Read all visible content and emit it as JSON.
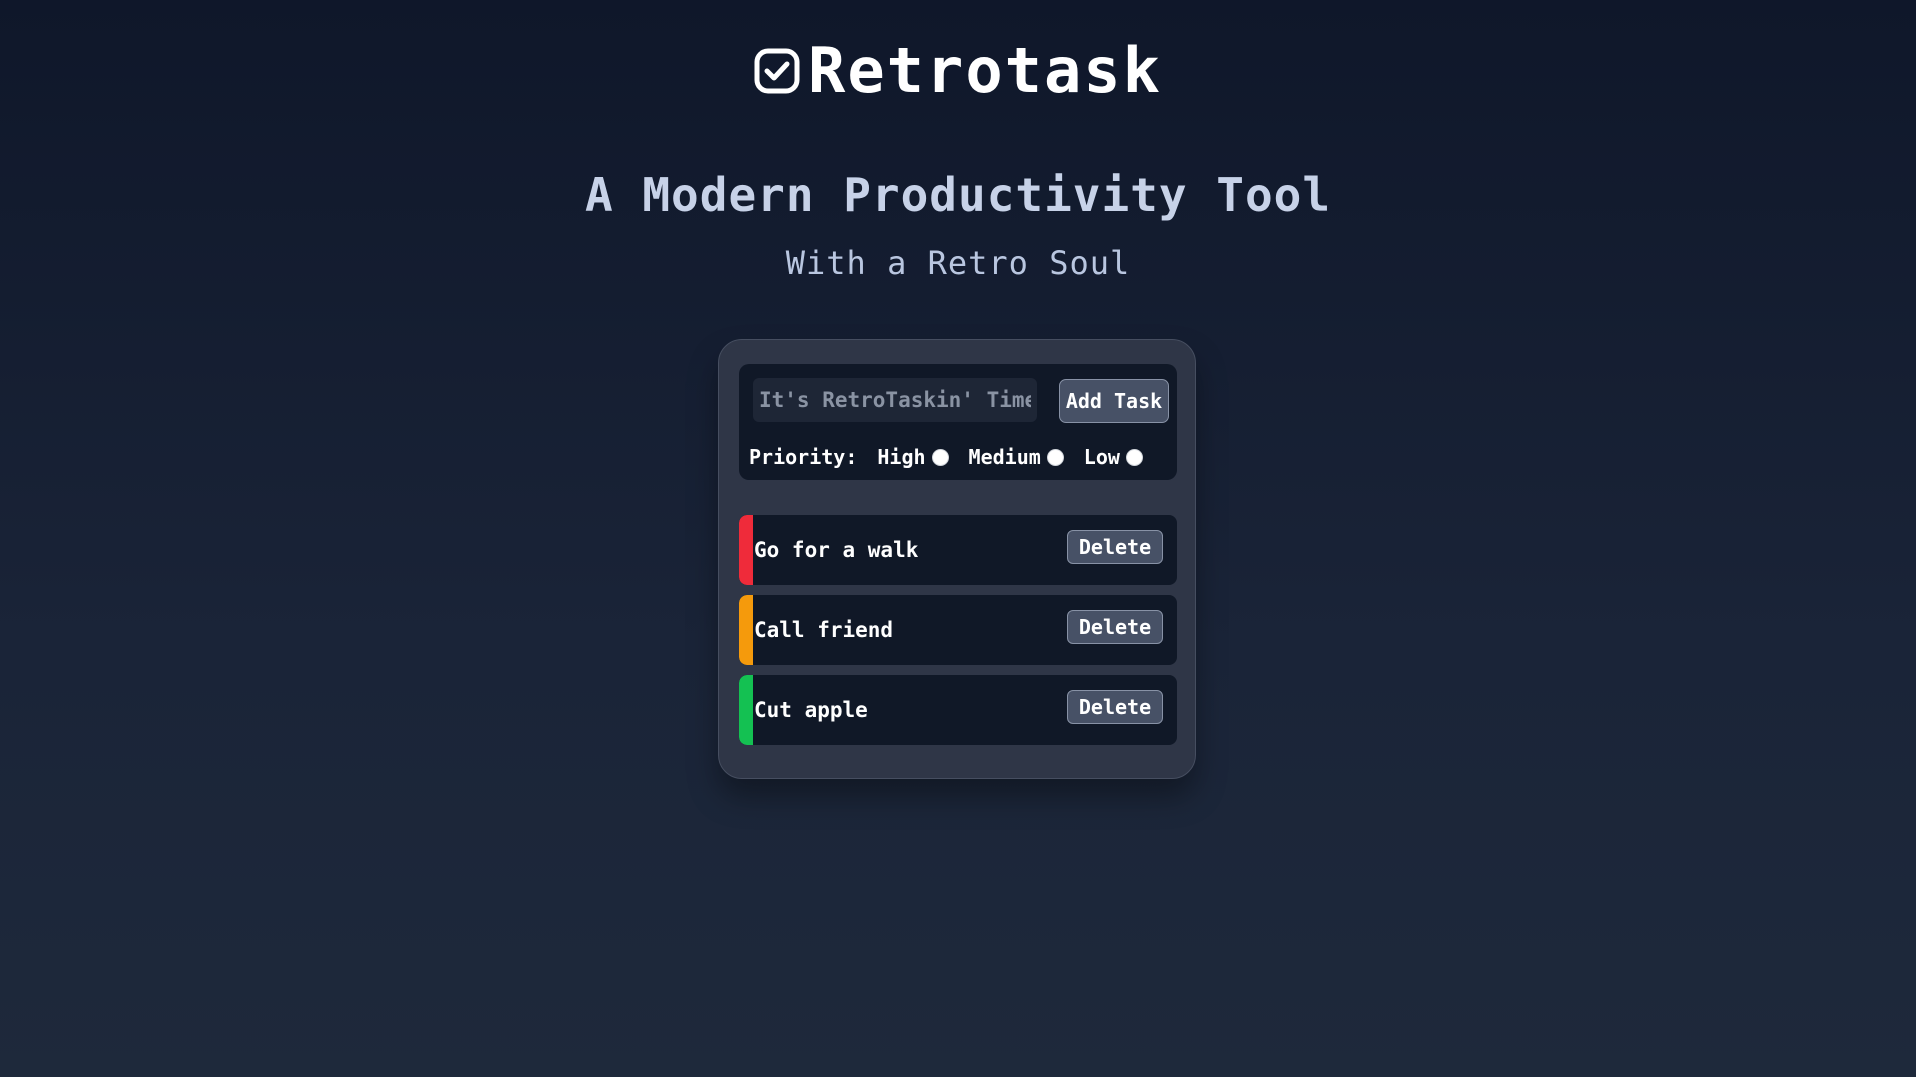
{
  "app": {
    "title": "Retrotask",
    "logo_icon": "check-square-icon"
  },
  "hero": {
    "tagline": "A Modern Productivity Tool",
    "subtagline": "With a Retro Soul"
  },
  "form": {
    "input_value": "",
    "input_placeholder": "It's RetroTaskin' Time.",
    "add_button_label": "Add Task",
    "priority_label": "Priority:",
    "priority_options": [
      {
        "label": "High",
        "selected": false
      },
      {
        "label": "Medium",
        "selected": false
      },
      {
        "label": "Low",
        "selected": false
      }
    ]
  },
  "tasks": [
    {
      "text": "Go for a walk",
      "priority": "High",
      "color": "#ef2b3a",
      "delete_label": "Delete"
    },
    {
      "text": "Call friend",
      "priority": "Medium",
      "color": "#f59a0c",
      "delete_label": "Delete"
    },
    {
      "text": "Cut apple",
      "priority": "Low",
      "color": "#14c152",
      "delete_label": "Delete"
    }
  ],
  "colors": {
    "background_top": "#0f172a",
    "background_bottom": "#1e293b",
    "card": "#2f3647",
    "panel": "#101827",
    "button": "#475166",
    "high": "#ef2b3a",
    "medium": "#f59a0c",
    "low": "#14c152"
  }
}
